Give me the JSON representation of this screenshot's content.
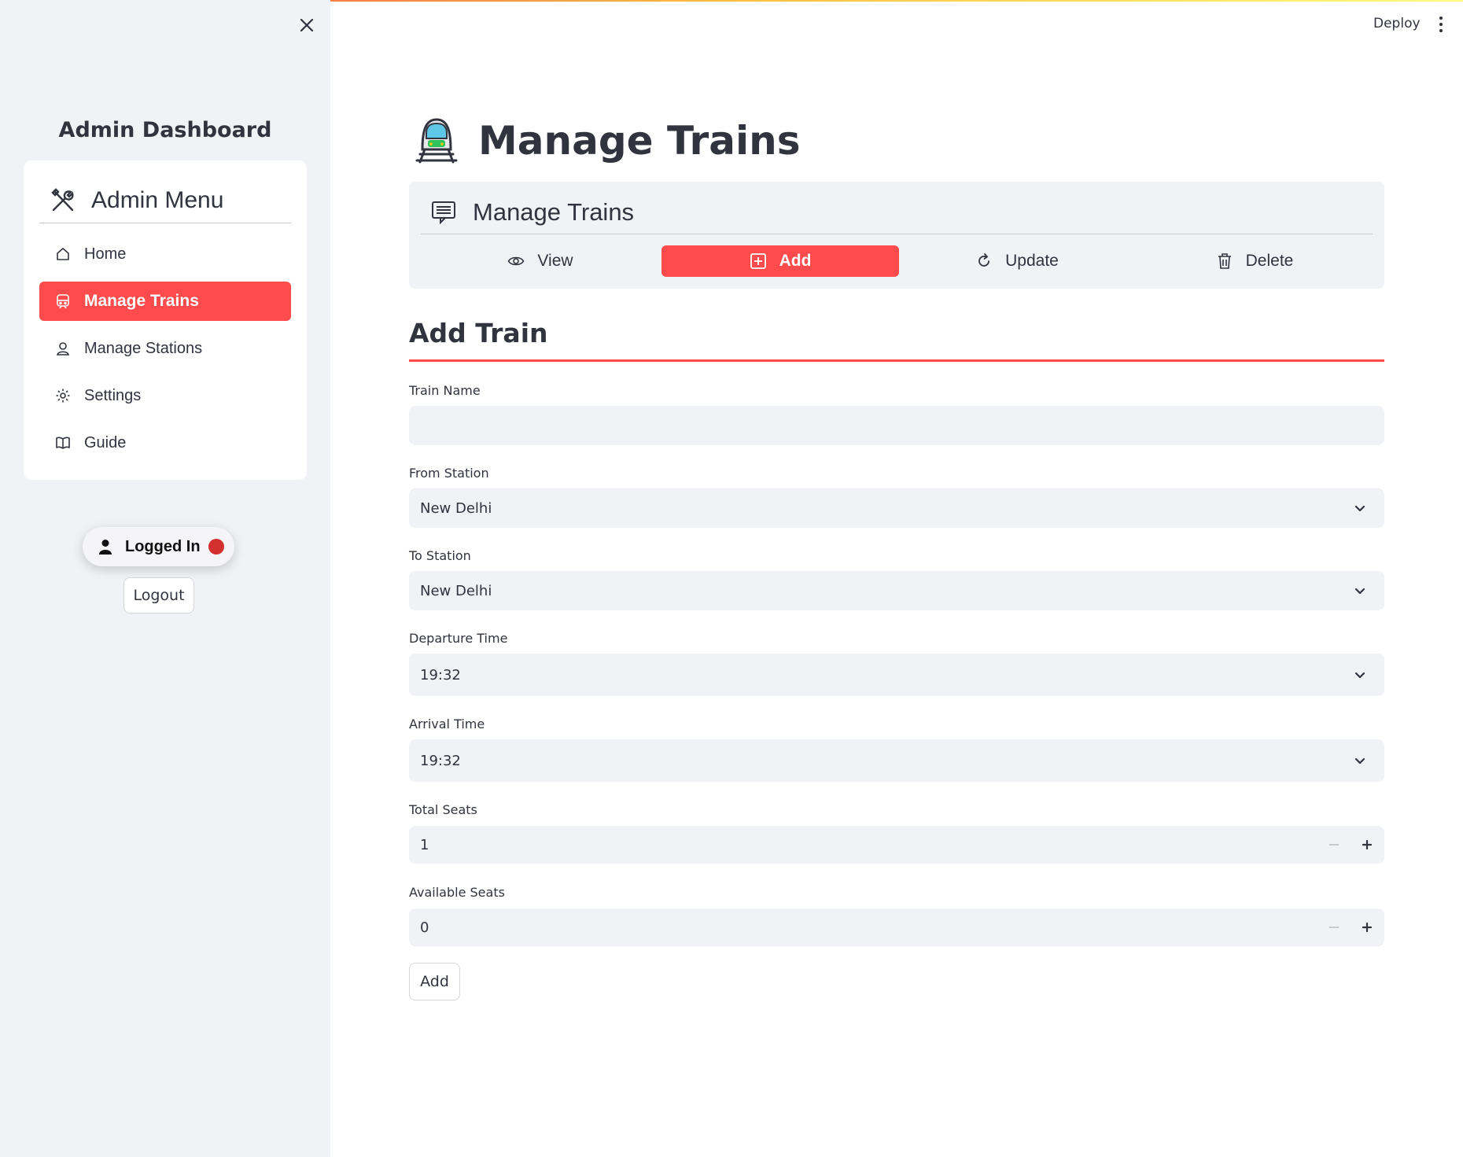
{
  "app": {
    "deploy_label": "Deploy",
    "accent_color": "#ff4b4b"
  },
  "sidebar": {
    "title": "Admin Dashboard",
    "menu_title": "Admin Menu",
    "menu_icon": "tools-icon",
    "items": [
      {
        "label": "Home",
        "icon": "home-icon",
        "active": false
      },
      {
        "label": "Manage Trains",
        "icon": "train-icon",
        "active": true
      },
      {
        "label": "Manage Stations",
        "icon": "station-icon",
        "active": false
      },
      {
        "label": "Settings",
        "icon": "gear-icon",
        "active": false
      },
      {
        "label": "Guide",
        "icon": "book-icon",
        "active": false
      }
    ],
    "status": {
      "label": "Logged In",
      "dot_color": "#d32f2f"
    },
    "logout_label": "Logout"
  },
  "main": {
    "page_title": "Manage Trains",
    "page_title_icon": "train-emoji-icon",
    "tabs_card": {
      "title": "Manage Trains",
      "icon": "list-icon",
      "tabs": [
        {
          "label": "View",
          "icon": "eye-icon",
          "active": false
        },
        {
          "label": "Add",
          "icon": "plus-square-icon",
          "active": true
        },
        {
          "label": "Update",
          "icon": "refresh-icon",
          "active": false
        },
        {
          "label": "Delete",
          "icon": "trash-icon",
          "active": false
        }
      ]
    },
    "form": {
      "title": "Add Train",
      "train_name": {
        "label": "Train Name",
        "value": ""
      },
      "from_station": {
        "label": "From Station",
        "value": "New Delhi"
      },
      "to_station": {
        "label": "To Station",
        "value": "New Delhi"
      },
      "departure_time": {
        "label": "Departure Time",
        "value": "19:32"
      },
      "arrival_time": {
        "label": "Arrival Time",
        "value": "19:32"
      },
      "total_seats": {
        "label": "Total Seats",
        "value": "1"
      },
      "available_seats": {
        "label": "Available Seats",
        "value": "0"
      },
      "submit_label": "Add"
    }
  }
}
